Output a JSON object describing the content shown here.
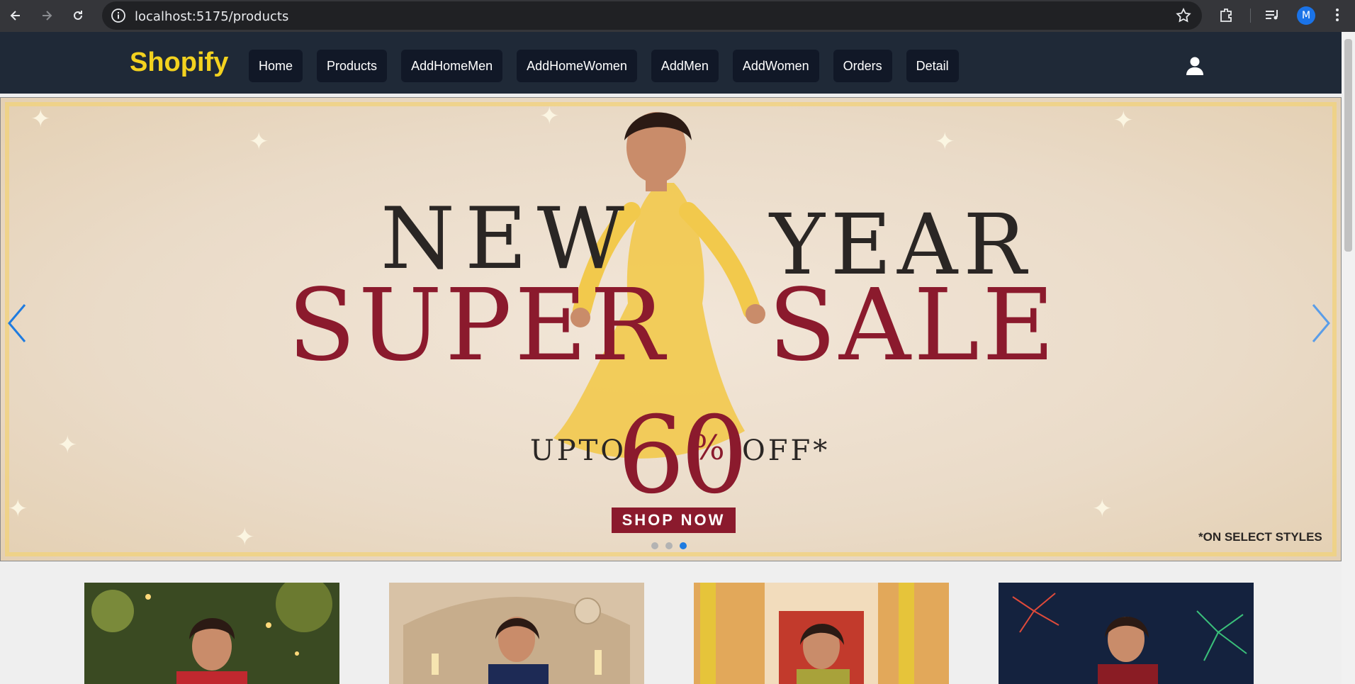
{
  "browser": {
    "url": "localhost:5175/products",
    "profile_initial": "M",
    "icons": [
      "back-arrow-icon",
      "forward-arrow-icon",
      "reload-icon",
      "info-icon",
      "star-icon",
      "extensions-icon",
      "media-icon",
      "menu-dots-icon"
    ]
  },
  "header": {
    "logo": "Shopify",
    "nav": [
      {
        "label": "Home"
      },
      {
        "label": "Products"
      },
      {
        "label": "AddHomeMen"
      },
      {
        "label": "AddHomeWomen"
      },
      {
        "label": "AddMen"
      },
      {
        "label": "AddWomen"
      },
      {
        "label": "Orders"
      },
      {
        "label": "Detail"
      }
    ],
    "user_icon": "user-icon",
    "colors": {
      "bg": "#1f2937",
      "logo": "#f3d21f",
      "nav_button": "#111827"
    }
  },
  "banner": {
    "line1_left": "NEW",
    "line1_right": "YEAR",
    "line2_left": "SUPER",
    "line2_right": "SALE",
    "upto": "UPTO",
    "discount": "60",
    "percent": "%",
    "off": "OFF*",
    "cta": "SHOP NOW",
    "disclaimer": "*ON SELECT STYLES",
    "slide_count": 3,
    "active_slide": 3,
    "colors": {
      "maroon": "#8b1a2d",
      "dark": "#2a2624",
      "dress": "#f2c94c",
      "dot_active": "#1e7be0"
    }
  },
  "products": {
    "cards": [
      {
        "scene": "garden-lights"
      },
      {
        "scene": "candle-interior"
      },
      {
        "scene": "marigold-stairs"
      },
      {
        "scene": "fireworks-night"
      }
    ]
  }
}
